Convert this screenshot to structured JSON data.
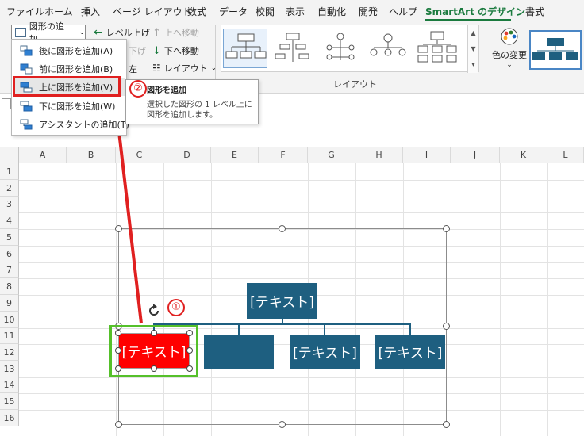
{
  "ribbon_tabs": [
    {
      "label": "ファイル",
      "active": false
    },
    {
      "label": "ホーム",
      "active": false
    },
    {
      "label": "挿入",
      "active": false
    },
    {
      "label": "ページ レイアウト",
      "active": false
    },
    {
      "label": "数式",
      "active": false
    },
    {
      "label": "データ",
      "active": false
    },
    {
      "label": "校閲",
      "active": false
    },
    {
      "label": "表示",
      "active": false
    },
    {
      "label": "自動化",
      "active": false
    },
    {
      "label": "開発",
      "active": false
    },
    {
      "label": "ヘルプ",
      "active": false
    },
    {
      "label": "SmartArt のデザイン",
      "active": true
    },
    {
      "label": "書式",
      "active": false
    }
  ],
  "accent_color": "#1a7a3e",
  "ribbon": {
    "add_shape_label": "図形の追加",
    "level_up_label": "レベル上げ",
    "level_down_label": "下げ",
    "move_up_label": "上へ移動",
    "move_down_label": "下へ移動",
    "layout_label": "レイアウト",
    "rtl_label": "左",
    "layout_group_label": "レイアウト",
    "color_change_label": "色の変更"
  },
  "menu": {
    "items": [
      {
        "label": "後に図形を追加(A)",
        "highlight": false
      },
      {
        "label": "前に図形を追加(B)",
        "highlight": false
      },
      {
        "label": "上に図形を追加(V)",
        "highlight": true
      },
      {
        "label": "下に図形を追加(W)",
        "highlight": false
      },
      {
        "label": "アシスタントの追加(T)",
        "highlight": false
      }
    ]
  },
  "tooltip": {
    "title": "図形を追加",
    "description": "選択した図形の 1 レベル上に図形を追加します。"
  },
  "annotations": {
    "step1": "①",
    "step2": "②",
    "color": "#e02020"
  },
  "sheet": {
    "columns": [
      "A",
      "B",
      "C",
      "D",
      "E",
      "F",
      "G",
      "H",
      "I",
      "J",
      "K",
      "L"
    ],
    "rows": [
      "1",
      "2",
      "3",
      "4",
      "5",
      "6",
      "7",
      "8",
      "9",
      "10",
      "11",
      "12",
      "13",
      "14",
      "15",
      "16"
    ]
  },
  "smartart": {
    "top_text": "[テキスト]",
    "selected_text": "[テキスト]",
    "child2_text": "",
    "child3_text": "[テキスト]",
    "child4_text": "[テキスト]",
    "shape_color": "#1e5f80",
    "selected_color": "#ff0000"
  }
}
